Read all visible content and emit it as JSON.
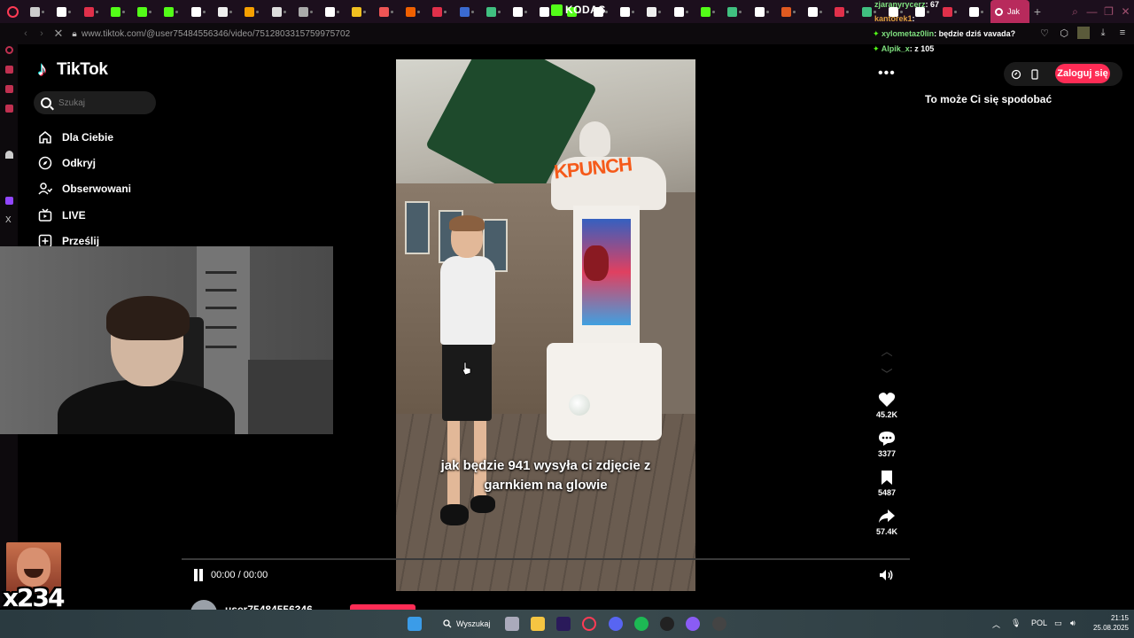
{
  "browser": {
    "url": "www.tiktok.com/@user75484556346/video/7512803315759975702",
    "active_tab_label": "Jak"
  },
  "tiktok": {
    "brand": "TikTok",
    "search_placeholder": "Szukaj",
    "nav": [
      {
        "label": "Dla Ciebie",
        "icon": "home-icon"
      },
      {
        "label": "Odkryj",
        "icon": "compass-icon"
      },
      {
        "label": "Obserwowani",
        "icon": "following-icon"
      },
      {
        "label": "LIVE",
        "icon": "live-icon"
      },
      {
        "label": "Prześlij",
        "icon": "upload-icon"
      }
    ],
    "login_label": "Zaloguj się",
    "suggest_title": "To może Ci się spodobać",
    "more_label": "•••"
  },
  "video": {
    "caption_line1": "jak będzie 941 wysyła ci zdjęcie z",
    "caption_line2": "garnkiem na glowie",
    "machine_text": "KPUNCH",
    "time": "00:00 / 00:00",
    "progress": 0.0
  },
  "actions": [
    {
      "name": "like",
      "count": "45.2K",
      "icon": "heart-icon"
    },
    {
      "name": "comment",
      "count": "3377",
      "icon": "comment-icon"
    },
    {
      "name": "save",
      "count": "5487",
      "icon": "bookmark-icon"
    },
    {
      "name": "share",
      "count": "57.4K",
      "icon": "share-icon"
    }
  ],
  "author": {
    "name": "user75484556346"
  },
  "chat": [
    {
      "user": "zjaranyrycerz",
      "message": ": 67",
      "color": "#7fe07f"
    },
    {
      "user": "kantorek1",
      "message": ":",
      "color": "#e0a040"
    },
    {
      "user": "xylometaz0lin",
      "message": ": będzie dziś vavada?",
      "color": "#7fe07f"
    },
    {
      "user": "Alpik_x",
      "message": ": z 105",
      "color": "#7fe07f"
    }
  ],
  "overlay": {
    "kodas_label": "KODAS",
    "emote_count": "x234"
  },
  "taskbar": {
    "search_label": "Wyszukaj",
    "language": "POL",
    "time": "21:15",
    "date": "25.08.2025"
  },
  "colors": {
    "tiktok_red": "#fe2c55",
    "active_tab": "#b82a5c",
    "kick_green": "#53fc18"
  }
}
